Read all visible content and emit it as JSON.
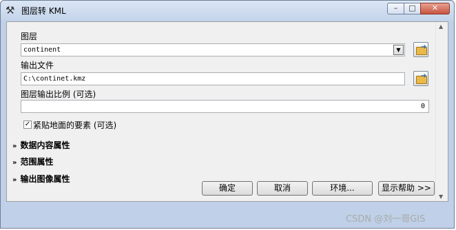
{
  "window": {
    "title": "图层转 KML",
    "title_icon": "hammer-icon",
    "controls": {
      "minimize": "–",
      "maximize": "□",
      "close": "✕"
    }
  },
  "fields": {
    "layer": {
      "label": "图层",
      "value": "continent"
    },
    "output": {
      "label": "输出文件",
      "value": "C:\\continet.kmz"
    },
    "scale": {
      "label": "图层输出比例 (可选)",
      "value": "0"
    },
    "clamp": {
      "label": "紧贴地面的要素 (可选)",
      "checked": true
    }
  },
  "sections": [
    {
      "label": "数据内容属性"
    },
    {
      "label": "范围属性"
    },
    {
      "label": "输出图像属性"
    }
  ],
  "buttons": {
    "ok": "确定",
    "cancel": "取消",
    "env": "环境...",
    "help": "显示帮助 >>"
  },
  "watermark": "CSDN @刘一哥GIS"
}
